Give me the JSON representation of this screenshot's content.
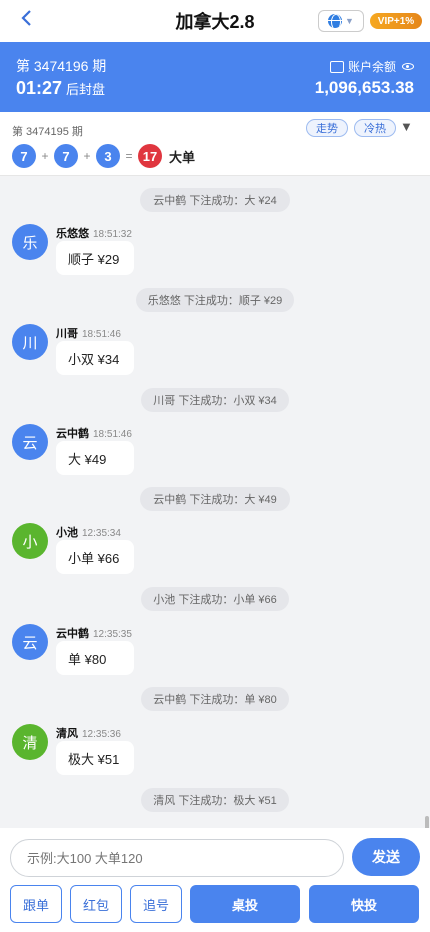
{
  "header": {
    "back_icon": "chevron-left-icon",
    "title": "加拿大2.8",
    "language_icon": "globe-icon",
    "vip_badge": "VIP+1%"
  },
  "period": {
    "issue_label": "第 3474196 期",
    "countdown": "01:27",
    "close_label": "后封盘",
    "balance_label": "账户余额",
    "balance": "1,096,653.38"
  },
  "last_result": {
    "issue_label": "第 3474195 期",
    "balls": [
      "7",
      "7",
      "3"
    ],
    "plus": "+",
    "equals": "=",
    "total": "17",
    "result_type": "大单",
    "trend_btn": "走势",
    "hot_btn": "冷热",
    "dropdown_icon": "triangle-down-icon"
  },
  "chat": {
    "sys_top": "云中鹤 下注成功：大 ¥24",
    "messages": [
      {
        "avatar": "乐",
        "avatar_color": "#4a84ee",
        "name": "乐悠悠",
        "time": "18:51:32",
        "text": "顺子 ¥29",
        "confirm": "乐悠悠 下注成功：顺子 ¥29"
      },
      {
        "avatar": "川",
        "avatar_color": "#4a84ee",
        "name": "川哥",
        "time": "18:51:46",
        "text": "小双 ¥34",
        "confirm": "川哥 下注成功：小双 ¥34"
      },
      {
        "avatar": "云",
        "avatar_color": "#4a84ee",
        "name": "云中鹤",
        "time": "18:51:46",
        "text": "大 ¥49",
        "confirm": "云中鹤 下注成功：大 ¥49"
      },
      {
        "avatar": "小",
        "avatar_color": "#5ab52e",
        "name": "小池",
        "time": "12:35:34",
        "text": "小单 ¥66",
        "confirm": "小池 下注成功：小单 ¥66"
      },
      {
        "avatar": "云",
        "avatar_color": "#4a84ee",
        "name": "云中鹤",
        "time": "12:35:35",
        "text": "单 ¥80",
        "confirm": "云中鹤 下注成功：单 ¥80"
      },
      {
        "avatar": "清",
        "avatar_color": "#5ab52e",
        "name": "清风",
        "time": "12:35:36",
        "text": "极大 ¥51",
        "confirm": "清风 下注成功：极大 ¥51"
      }
    ]
  },
  "input": {
    "placeholder": "示例:大100 大单120",
    "send": "发送"
  },
  "actions": {
    "follow": "跟单",
    "red_packet": "红包",
    "chase": "追号",
    "table_bet": "桌投",
    "quick_bet": "快投"
  }
}
